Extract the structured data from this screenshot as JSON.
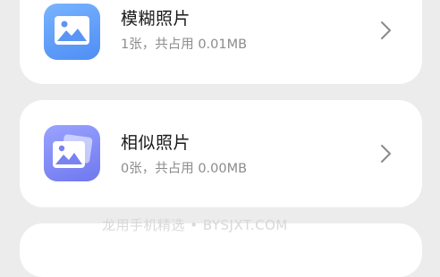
{
  "items": [
    {
      "title": "模糊照片",
      "subtitle": "1张，共占用 0.01MB",
      "icon": "blurry-photo-icon",
      "color": "#5a9bfa"
    },
    {
      "title": "相似照片",
      "subtitle": "0张，共占用 0.00MB",
      "icon": "similar-photos-icon",
      "color": "#7e86f2"
    }
  ],
  "watermark": "龙用手机精选 • BYSJXT.COM"
}
